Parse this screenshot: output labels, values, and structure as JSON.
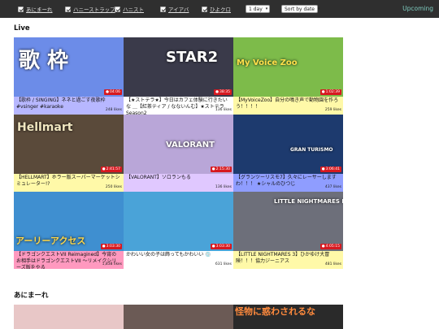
{
  "filters": [
    {
      "label": "あにまーれ"
    },
    {
      "label": "ハニーストラップ"
    },
    {
      "label": "ハニスト"
    },
    {
      "label": "アイアバ"
    },
    {
      "label": "ひよクロ"
    }
  ],
  "duration_select": {
    "value": "1 day"
  },
  "sort_select": {
    "value": "Sort by date"
  },
  "upcoming_label": "Upcoming",
  "live_section": {
    "title": "Live"
  },
  "second_section": {
    "title": "あにまーれ"
  },
  "videos": [
    {
      "duration": "04:06",
      "likes": "248 likes",
      "title": "【歌枠 / SINGING】ネネと過ごす夜歌枠 #vsinger #karaoke",
      "caption_bg": "#b7b7ff",
      "thumb_text": "歌 枠",
      "thumb_bg": "#6c8ce8"
    },
    {
      "duration": "38:35",
      "likes": "136 likes",
      "title": "【★ストテラ★】今日はカフェ体験に行きたいな ＿【紅茶ティア / なないんむ】★ストテラSeason2",
      "caption_bg": "#ffffff",
      "thumb_text": "STAR2",
      "thumb_bg": "#3a3a4a"
    },
    {
      "duration": "1:02:39",
      "likes": "259 likes",
      "title": "【MyVoiceZoo】自分の鳴き声で動物園を作ろう！！！！",
      "caption_bg": "#fff9a8",
      "thumb_text": "My Voice Zoo",
      "thumb_bg": "#7dbb4a"
    },
    {
      "duration": "2:41:57",
      "likes": "250 likes",
      "title": "【HELLMART】ホラー版スーパーマーケットシミュレーター!?",
      "caption_bg": "#fff9a8",
      "thumb_text": "Hellmart",
      "thumb_bg": "#5a4a3a"
    },
    {
      "duration": "2:15:30",
      "likes": "136 likes",
      "title": "【VALORANT】ソロランもる",
      "caption_bg": "#e0c8ff",
      "thumb_text": "VALORANT",
      "thumb_bg": "#b9a6d8"
    },
    {
      "duration": "3:06:41",
      "likes": "437 likes",
      "title": "【グランツーリスモ7】久々にレーサーしますわ！！！ ★シャルのひつじ",
      "caption_bg": "#8f9dff",
      "thumb_text": "GRAN TURISMO",
      "thumb_bg": "#1d3a6e"
    },
    {
      "duration": "3:03:30",
      "likes": "1,838 likes",
      "title": "【ドラゴンクエストVII Reimagined】今宵のお相手はドラゴンクエストVII ～リメイクシリーズ版をやる",
      "caption_bg": "#ff99bf",
      "thumb_text": "アーリーアクセス",
      "thumb_bg": "#3f8fd0"
    },
    {
      "duration": "3:03:30",
      "likes": "631 likes",
      "title": "かわいい女の子は飾ってもかわいい 💿",
      "caption_bg": "#ffffff",
      "thumb_text": "",
      "thumb_bg": "#4aa3d8"
    },
    {
      "duration": "4:05:15",
      "likes": "481 likes",
      "title": "【LITTLE NIGHTMARES 3】ひかゆけ大冒険！！！協力ジーニアス",
      "caption_bg": "#fff9a8",
      "thumb_text": "LITTLE NIGHTMARES III",
      "thumb_bg": "#6d6f7a"
    }
  ],
  "second_row_thumbs": [
    {
      "thumb_bg": "#e8c7c7"
    },
    {
      "thumb_bg": "#6b5a55"
    },
    {
      "thumb_bg": "#2a2a2a",
      "thumb_text": "怪物に惑わされるな"
    }
  ]
}
